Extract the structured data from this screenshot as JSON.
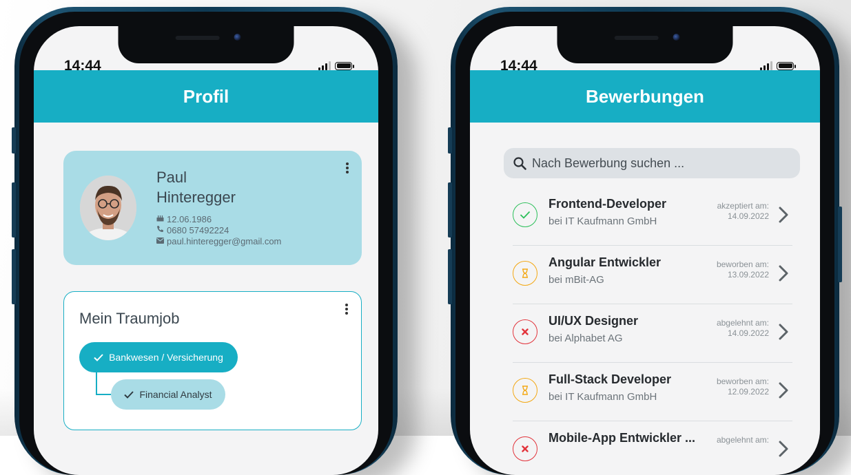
{
  "colors": {
    "accent": "#17aec4",
    "accent_light": "#a9dce6",
    "accepted": "#2cbf5a",
    "pending": "#f3a814",
    "rejected": "#e2343c"
  },
  "left_phone": {
    "status_time": "14:44",
    "header_title": "Profil",
    "profile": {
      "first_name": "Paul",
      "last_name": "Hinteregger",
      "birthdate": "12.06.1986",
      "phone": "0680 57492224",
      "email": "paul.hinteregger@gmail.com",
      "icons": [
        "cake-icon",
        "phone-icon",
        "mail-icon",
        "more-vert-icon"
      ]
    },
    "dream_job": {
      "title": "Mein Traumjob",
      "category": "Bankwesen / Versicherung",
      "position": "Financial Analyst",
      "icons": [
        "check-icon",
        "more-vert-icon"
      ]
    }
  },
  "right_phone": {
    "status_time": "14:44",
    "header_title": "Bewerbungen",
    "search": {
      "placeholder": "Nach Bewerbung suchen ...",
      "icon": "search-icon"
    },
    "applications": [
      {
        "title": "Frontend-Developer",
        "company": "bei IT Kaufmann GmbH",
        "status_label": "akzeptiert am:",
        "date": "14.09.2022",
        "status": "accepted"
      },
      {
        "title": "Angular Entwickler",
        "company": "bei mBit-AG",
        "status_label": "beworben am:",
        "date": "13.09.2022",
        "status": "pending"
      },
      {
        "title": "UI/UX Designer",
        "company": "bei Alphabet AG",
        "status_label": "abgelehnt am:",
        "date": "14.09.2022",
        "status": "rejected"
      },
      {
        "title": "Full-Stack Developer",
        "company": "bei IT Kaufmann GmbH",
        "status_label": "beworben am:",
        "date": "12.09.2022",
        "status": "pending"
      },
      {
        "title": "Mobile-App Entwickler ...",
        "company": "",
        "status_label": "abgelehnt am:",
        "date": "",
        "status": "rejected"
      }
    ]
  }
}
